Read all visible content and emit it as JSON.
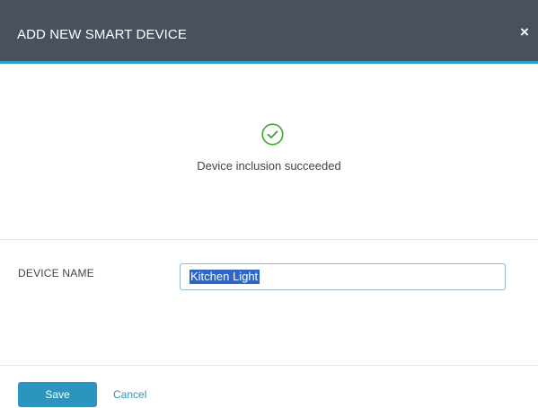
{
  "dialog": {
    "title": "ADD NEW SMART DEVICE",
    "close_label": "×"
  },
  "status": {
    "icon": "check-circle-icon",
    "message": "Device inclusion succeeded",
    "color": "#3fa535"
  },
  "form": {
    "device_name_label": "DEVICE NAME",
    "device_name_value": "Kitchen Light"
  },
  "footer": {
    "save_label": "Save",
    "cancel_label": "Cancel"
  },
  "colors": {
    "header_bg": "#49515f",
    "accent": "#2b95c0",
    "success": "#3fa535"
  }
}
